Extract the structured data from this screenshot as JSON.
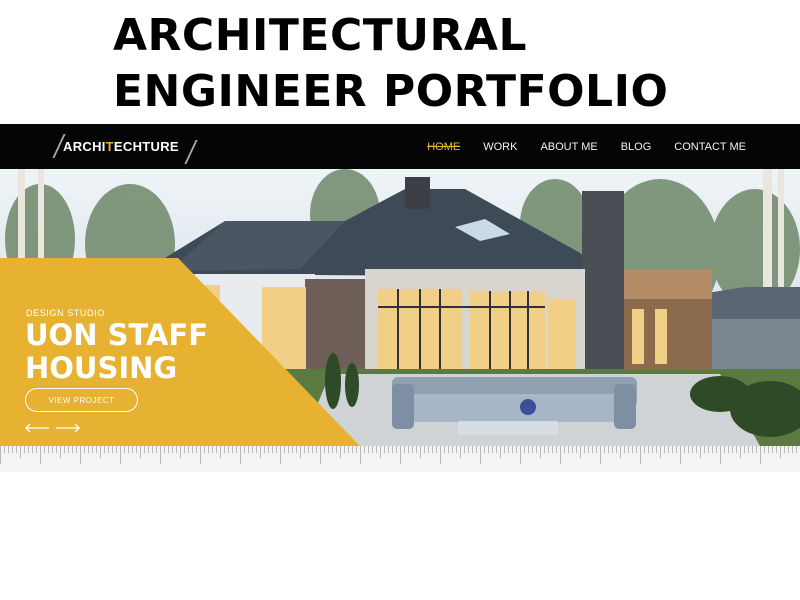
{
  "heading": {
    "line1": "ARCHITECTURAL",
    "line2": "ENGINEER PORTFOLIO"
  },
  "brand": {
    "part1": "ARCHI",
    "accent": "T",
    "part2": "ECHTURE",
    "accent_color": "#e8b830"
  },
  "nav": {
    "items": [
      {
        "label": "HOME",
        "active": true
      },
      {
        "label": "WORK",
        "active": false
      },
      {
        "label": "ABOUT ME",
        "active": false
      },
      {
        "label": "BLOG",
        "active": false
      },
      {
        "label": "CONTACT ME",
        "active": false
      }
    ]
  },
  "hero": {
    "label": "DESIGN STUDIO",
    "title_line1": "UON STAFF",
    "title_line2": "HOUSING",
    "button_label": "VIEW PROJECT",
    "prev_icon": "arrow-left-icon",
    "next_icon": "arrow-right-icon",
    "panel_color": "#e7b231"
  }
}
